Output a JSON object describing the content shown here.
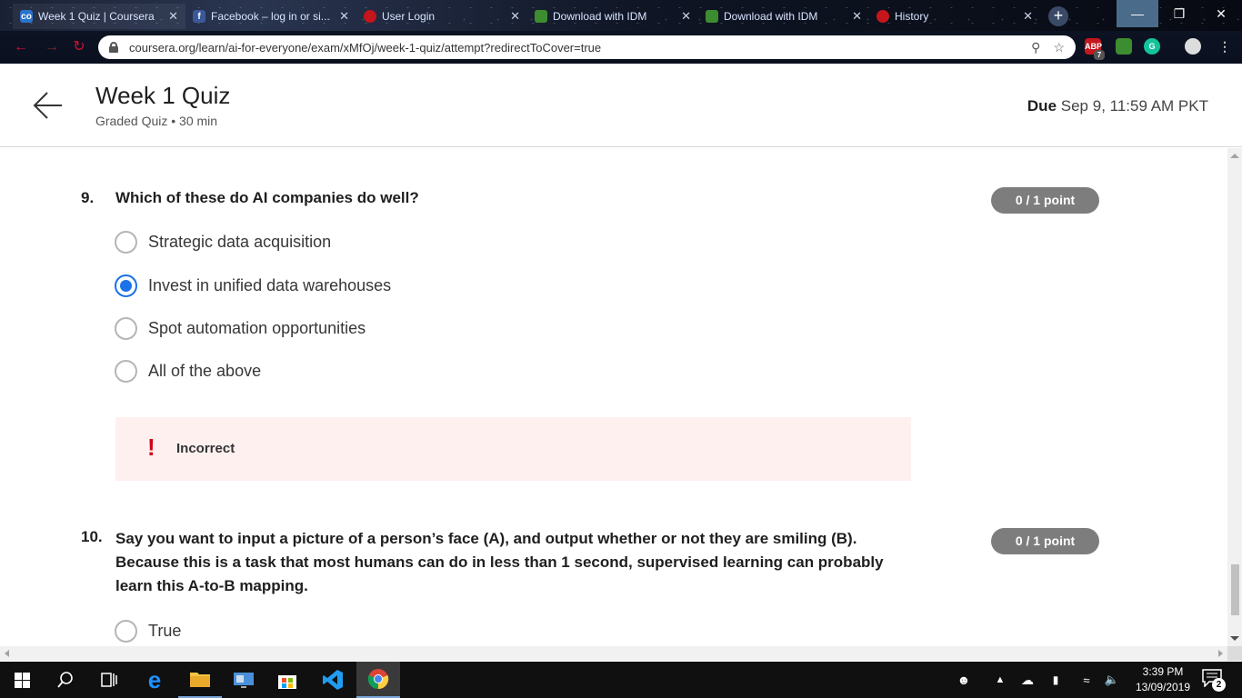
{
  "browser": {
    "tabs": [
      {
        "label": "Week 1 Quiz | Coursera",
        "active": true
      },
      {
        "label": "Facebook – log in or si..."
      },
      {
        "label": "User Login"
      },
      {
        "label": "Download with IDM"
      },
      {
        "label": "Download with IDM"
      },
      {
        "label": "History"
      }
    ],
    "url": "coursera.org/learn/ai-for-everyone/exam/xMfOj/week-1-quiz/attempt?redirectToCover=true",
    "extension_badge": "7"
  },
  "header": {
    "title": "Week 1 Quiz",
    "subtitle": "Graded Quiz • 30 min",
    "due_label": "Due",
    "due_value": "Sep 9, 11:59 AM PKT"
  },
  "questions": [
    {
      "number": "9.",
      "text": "Which of these do AI companies do well?",
      "points": "0 / 1 point",
      "options": [
        {
          "label": "Strategic data acquisition",
          "selected": false
        },
        {
          "label": "Invest in unified data warehouses",
          "selected": true
        },
        {
          "label": "Spot automation opportunities",
          "selected": false
        },
        {
          "label": "All of the above",
          "selected": false
        }
      ],
      "feedback": "Incorrect"
    },
    {
      "number": "10.",
      "text": "Say you want to input a picture of a person’s face (A), and output whether or not they are smiling (B). Because this is a task that most humans can do in less than 1 second, supervised learning can probably learn this A-to-B mapping.",
      "points": "0 / 1 point",
      "options": [
        {
          "label": "True",
          "selected": false
        }
      ]
    }
  ],
  "taskbar": {
    "time": "3:39 PM",
    "date": "13/09/2019",
    "notifications": "2"
  }
}
